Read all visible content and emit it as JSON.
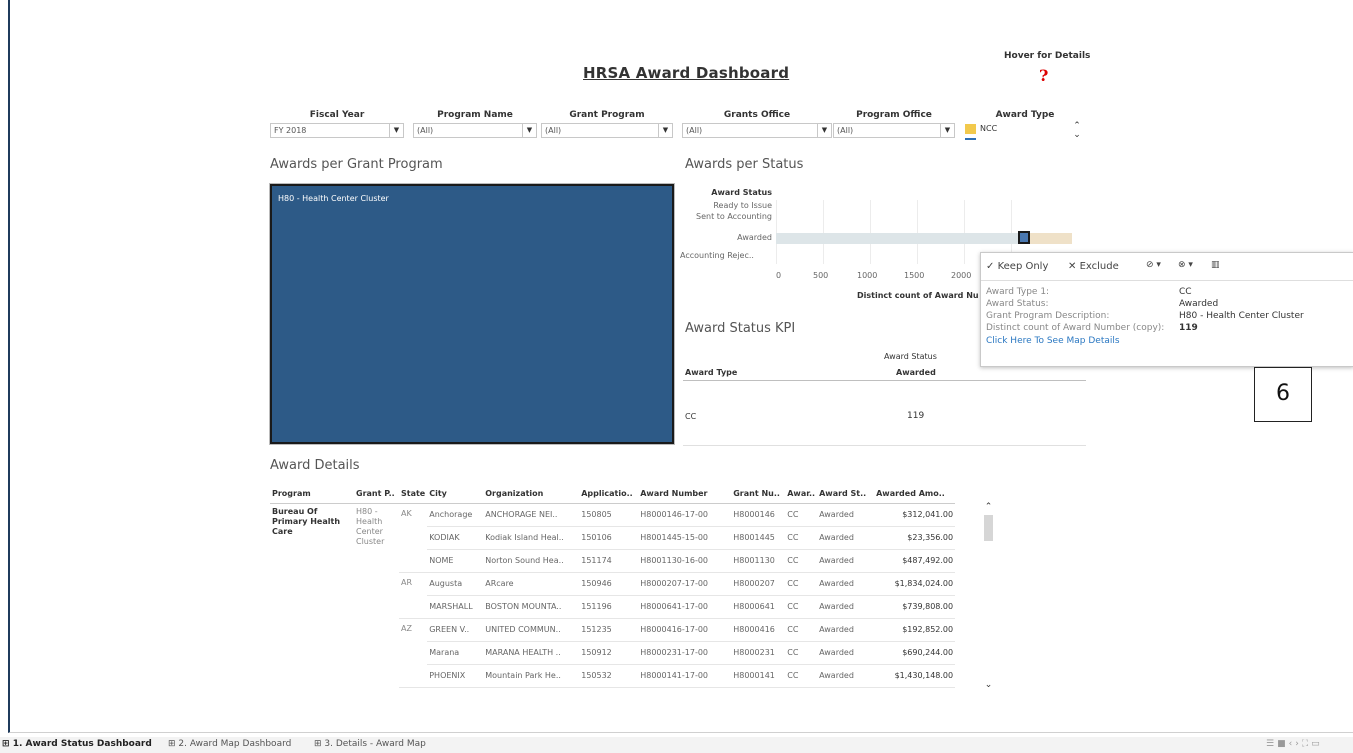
{
  "dashboard": {
    "title": "HRSA Award Dashboard",
    "hover_label": "Hover for Details",
    "hover_icon": "?"
  },
  "filters": [
    {
      "label": "Fiscal Year",
      "value": "FY 2018"
    },
    {
      "label": "Program Name",
      "value": "(All)"
    },
    {
      "label": "Grant Program",
      "value": "(All)"
    },
    {
      "label": "Grants Office",
      "value": "(All)"
    },
    {
      "label": "Program Office",
      "value": "(All)"
    }
  ],
  "award_type_legend": {
    "label": "Award Type",
    "item": "NCC",
    "color": "#f2c94c"
  },
  "treemap": {
    "title": "Awards per Grant Program",
    "cell_label": "H80 - Health Center Cluster",
    "color": "#2d5a87"
  },
  "status_chart": {
    "title": "Awards per Status",
    "header": "Award Status",
    "statuses": [
      "Ready to Issue",
      "Sent to Accounting",
      "Awarded",
      "Accounting Rejec.."
    ],
    "ticks": [
      "0",
      "500",
      "1000",
      "1500",
      "2000"
    ],
    "xlabel": "Distinct count of Award Nu",
    "highlighted_status": "Awarded"
  },
  "tooltip": {
    "keep_only": "Keep Only",
    "exclude": "Exclude",
    "rows": [
      {
        "key": "Award Type 1:",
        "value": "CC"
      },
      {
        "key": "Award Status:",
        "value": "Awarded"
      },
      {
        "key": "Grant Program Description:",
        "value": "H80 - Health Center Cluster"
      },
      {
        "key": "Distinct count of Award Number (copy):",
        "value": "119"
      }
    ],
    "link": "Click Here To See Map Details"
  },
  "kpi": {
    "title": "Award Status KPI",
    "col_header": "Award Status",
    "row_header": "Award Type",
    "col_value": "Awarded",
    "row_value": "CC",
    "cell_value": "119"
  },
  "annotation": {
    "number": "6"
  },
  "details": {
    "title": "Award Details",
    "columns": [
      "Program",
      "Grant P..",
      "State",
      "City",
      "Organization",
      "Applicatio..",
      "Award Number",
      "Grant Nu..",
      "Awar..",
      "Award St..",
      "Awarded Amo.."
    ],
    "program": "Bureau Of Primary Health Care",
    "grant_program": "H80 - Health Center Cluster",
    "rows": [
      {
        "state": "AK",
        "city": "Anchorage",
        "org": "ANCHORAGE NEI..",
        "app": "150805",
        "award": "H8000146-17-00",
        "grant": "H8000146",
        "type": "CC",
        "status": "Awarded",
        "amount": "$312,041.00"
      },
      {
        "state": "",
        "city": "KODIAK",
        "org": "Kodiak Island Heal..",
        "app": "150106",
        "award": "H8001445-15-00",
        "grant": "H8001445",
        "type": "CC",
        "status": "Awarded",
        "amount": "$23,356.00"
      },
      {
        "state": "",
        "city": "NOME",
        "org": "Norton Sound Hea..",
        "app": "151174",
        "award": "H8001130-16-00",
        "grant": "H8001130",
        "type": "CC",
        "status": "Awarded",
        "amount": "$487,492.00"
      },
      {
        "state": "AR",
        "city": "Augusta",
        "org": "ARcare",
        "app": "150946",
        "award": "H8000207-17-00",
        "grant": "H8000207",
        "type": "CC",
        "status": "Awarded",
        "amount": "$1,834,024.00"
      },
      {
        "state": "",
        "city": "MARSHALL",
        "org": "BOSTON MOUNTA..",
        "app": "151196",
        "award": "H8000641-17-00",
        "grant": "H8000641",
        "type": "CC",
        "status": "Awarded",
        "amount": "$739,808.00"
      },
      {
        "state": "AZ",
        "city": "GREEN V..",
        "org": "UNITED COMMUN..",
        "app": "151235",
        "award": "H8000416-17-00",
        "grant": "H8000416",
        "type": "CC",
        "status": "Awarded",
        "amount": "$192,852.00"
      },
      {
        "state": "",
        "city": "Marana",
        "org": "MARANA HEALTH ..",
        "app": "150912",
        "award": "H8000231-17-00",
        "grant": "H8000231",
        "type": "CC",
        "status": "Awarded",
        "amount": "$690,244.00"
      },
      {
        "state": "",
        "city": "PHOENIX",
        "org": "Mountain Park He..",
        "app": "150532",
        "award": "H8000141-17-00",
        "grant": "H8000141",
        "type": "CC",
        "status": "Awarded",
        "amount": "$1,430,148.00"
      }
    ]
  },
  "tabs": [
    "1. Award Status Dashboard",
    "2. Award Map Dashboard",
    "3. Details - Award Map"
  ]
}
